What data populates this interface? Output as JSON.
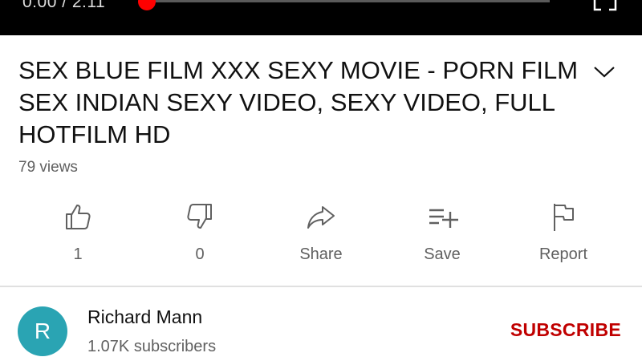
{
  "player": {
    "time_display": "0:00 / 2:11",
    "progress_fraction": 0.0
  },
  "video": {
    "title": "SEX BLUE FILM XXX SEXY MOVIE - PORN FILM SEX INDIAN SEXY VIDEO, SEXY VIDEO, FULL HOTFILM HD",
    "views": "79 views"
  },
  "actions": {
    "like": {
      "label": "1",
      "icon": "thumbs-up-icon"
    },
    "dislike": {
      "label": "0",
      "icon": "thumbs-down-icon"
    },
    "share": {
      "label": "Share",
      "icon": "share-arrow-icon"
    },
    "save": {
      "label": "Save",
      "icon": "playlist-add-icon"
    },
    "report": {
      "label": "Report",
      "icon": "flag-icon"
    }
  },
  "channel": {
    "avatar_letter": "R",
    "avatar_color": "#2aa4b3",
    "name": "Richard Mann",
    "subscribers": "1.07K subscribers",
    "subscribe_label": "SUBSCRIBE",
    "subscribe_color": "#c00000"
  },
  "colors": {
    "progress_knob": "#ff0000"
  }
}
